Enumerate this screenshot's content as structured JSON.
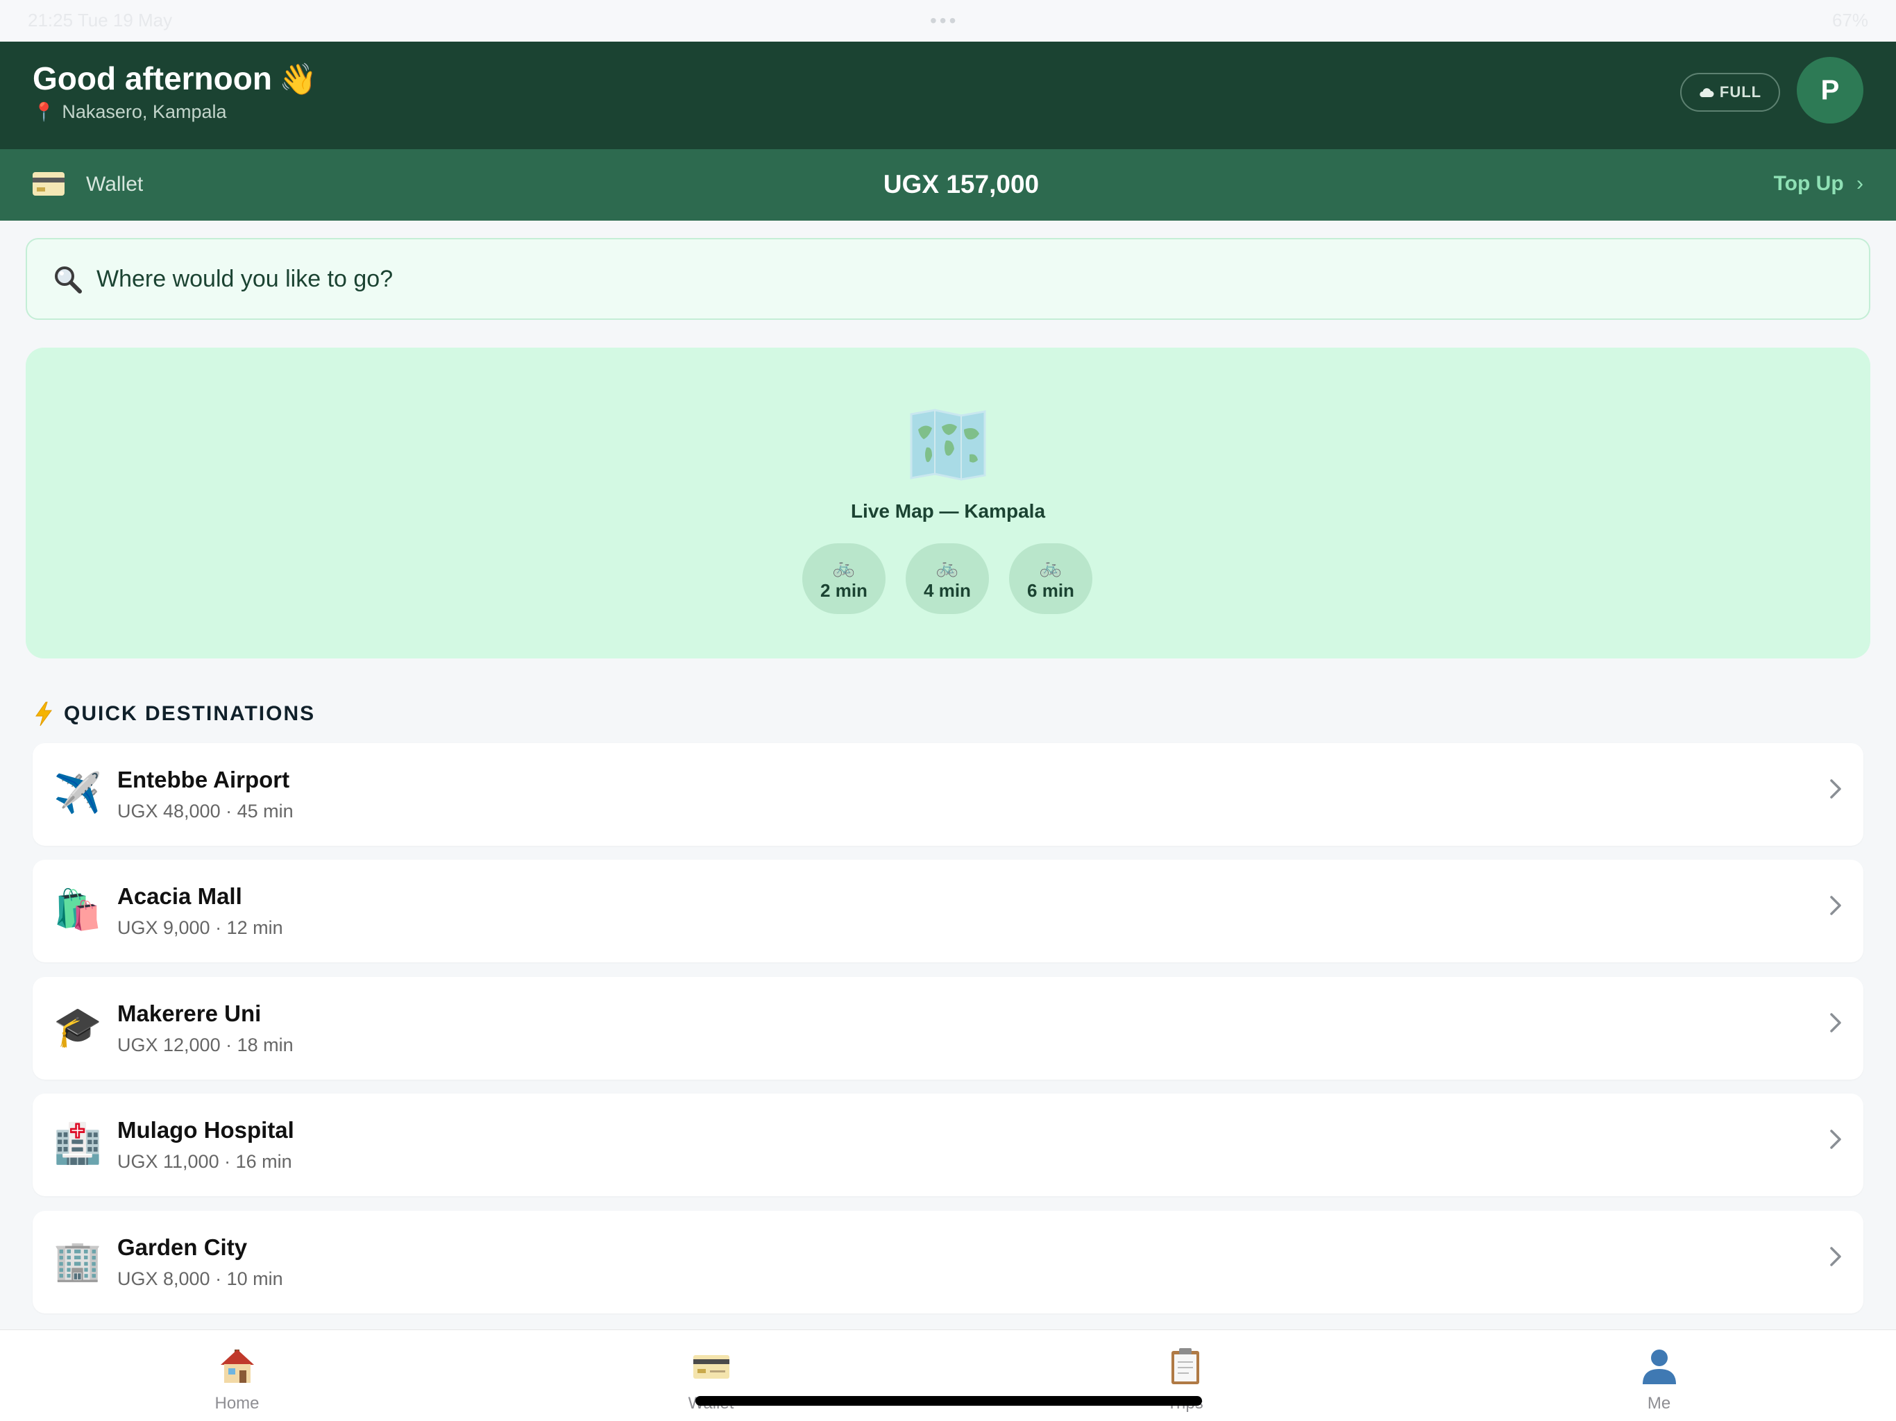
{
  "status_bar": {
    "time": "21:25  Tue 19 May",
    "right": "67%"
  },
  "header": {
    "greeting": "Good afternoon",
    "greeting_emoji": "👋",
    "location": "Nakasero, Kampala",
    "mode_badge": "FULL",
    "avatar_initial": "P"
  },
  "wallet": {
    "label": "Wallet",
    "balance": "UGX 157,000",
    "top_up": "Top Up",
    "top_up_chevron": "›"
  },
  "search": {
    "placeholder": "Where would you like to go?"
  },
  "map": {
    "title": "Live Map — Kampala",
    "etas": [
      {
        "icon": "🚲",
        "label": "2 min"
      },
      {
        "icon": "🚲",
        "label": "4 min"
      },
      {
        "icon": "🚲",
        "label": "6 min"
      }
    ]
  },
  "quick_destinations": {
    "title": "QUICK DESTINATIONS",
    "items": [
      {
        "icon": "✈️",
        "name": "Entebbe Airport",
        "meta": "UGX 48,000 · 45 min"
      },
      {
        "icon": "🛍️",
        "name": "Acacia Mall",
        "meta": "UGX 9,000 · 12 min"
      },
      {
        "icon": "🎓",
        "name": "Makerere Uni",
        "meta": "UGX 12,000 · 18 min"
      },
      {
        "icon": "🏥",
        "name": "Mulago Hospital",
        "meta": "UGX 11,000 · 16 min"
      },
      {
        "icon": "🏢",
        "name": "Garden City",
        "meta": "UGX 8,000 · 10 min"
      }
    ]
  },
  "tabs": [
    {
      "label": "Home",
      "icon": "house-icon"
    },
    {
      "label": "Wallet",
      "icon": "card-icon"
    },
    {
      "label": "Trips",
      "icon": "clipboard-icon"
    },
    {
      "label": "Me",
      "icon": "person-icon"
    }
  ],
  "colors": {
    "header": "#1b4332",
    "wallet_bar": "#2d6a4f",
    "accent": "#8fe0b5",
    "map_bg": "#d3f9e3"
  }
}
